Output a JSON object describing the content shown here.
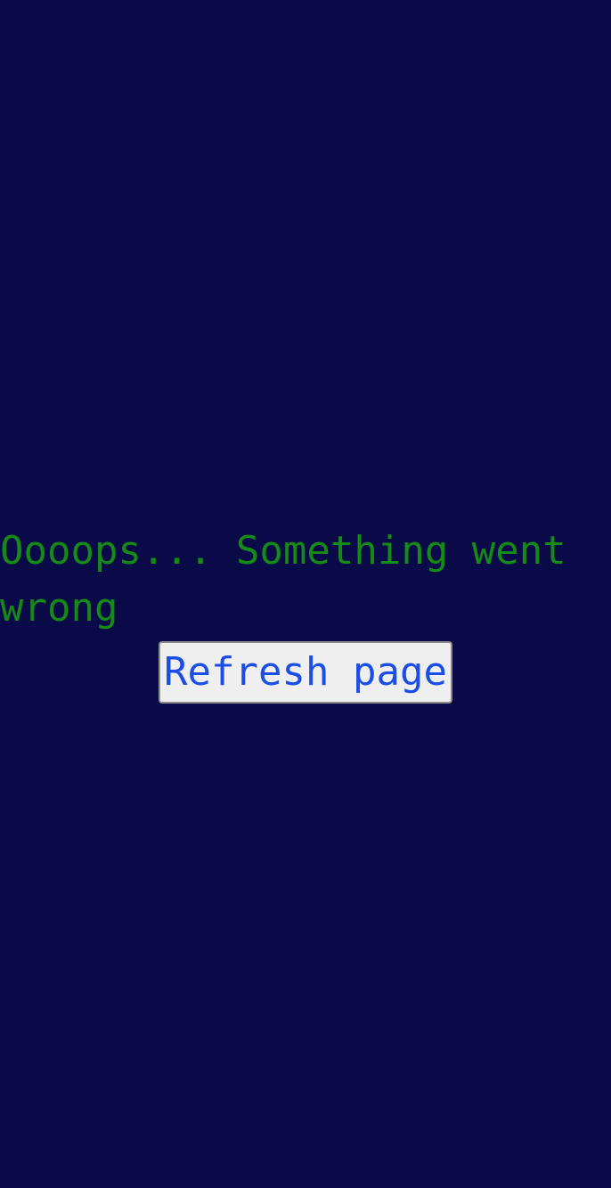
{
  "error": {
    "message": "Oooops... Something went wrong",
    "refresh_label": "Refresh page"
  },
  "colors": {
    "background": "#0a0a48",
    "message_text": "#168a16",
    "button_text": "#1a4ee6",
    "button_background": "#efefef",
    "button_border": "#8c8c8c"
  }
}
